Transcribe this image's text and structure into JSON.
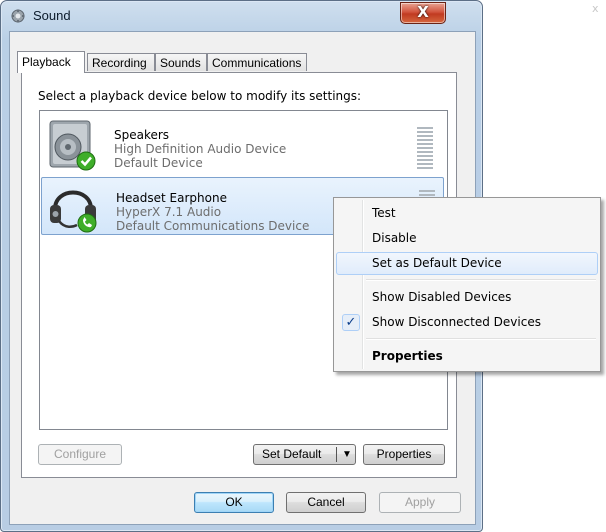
{
  "window": {
    "title": "Sound",
    "close_glyph": "X"
  },
  "tabs": [
    {
      "label": "Playback",
      "active": true
    },
    {
      "label": "Recording",
      "active": false
    },
    {
      "label": "Sounds",
      "active": false
    },
    {
      "label": "Communications",
      "active": false
    }
  ],
  "prompt": "Select a playback device below to modify its settings:",
  "devices": [
    {
      "name": "Speakers",
      "description": "High Definition Audio Device",
      "status": "Default Device",
      "icon": "speaker-icon",
      "badge": "default-device-check-icon",
      "selected": false
    },
    {
      "name": "Headset Earphone",
      "description": "HyperX 7.1 Audio",
      "status": "Default Communications Device",
      "icon": "headset-icon",
      "badge": "default-communications-phone-icon",
      "selected": true
    }
  ],
  "context_menu": {
    "items": [
      {
        "label": "Test",
        "checked": false,
        "bold": false,
        "hover": false
      },
      {
        "label": "Disable",
        "checked": false,
        "bold": false,
        "hover": false
      },
      {
        "label": "Set as Default Device",
        "checked": false,
        "bold": false,
        "hover": true
      },
      {
        "label": "Show Disabled Devices",
        "checked": false,
        "bold": false,
        "hover": false
      },
      {
        "label": "Show Disconnected Devices",
        "checked": true,
        "bold": false,
        "hover": false
      },
      {
        "label": "Properties",
        "checked": false,
        "bold": true,
        "hover": false
      }
    ],
    "check_glyph": "✓"
  },
  "buttons": {
    "configure": "Configure",
    "set_default": "Set Default",
    "set_default_arrow": "▼",
    "properties": "Properties",
    "ok": "OK",
    "cancel": "Cancel",
    "apply": "Apply"
  },
  "background_glyph": "x",
  "colors": {
    "selection_border": "#7da2ce",
    "close_button": "#c13a21",
    "default_badge": "#3fae2a"
  }
}
